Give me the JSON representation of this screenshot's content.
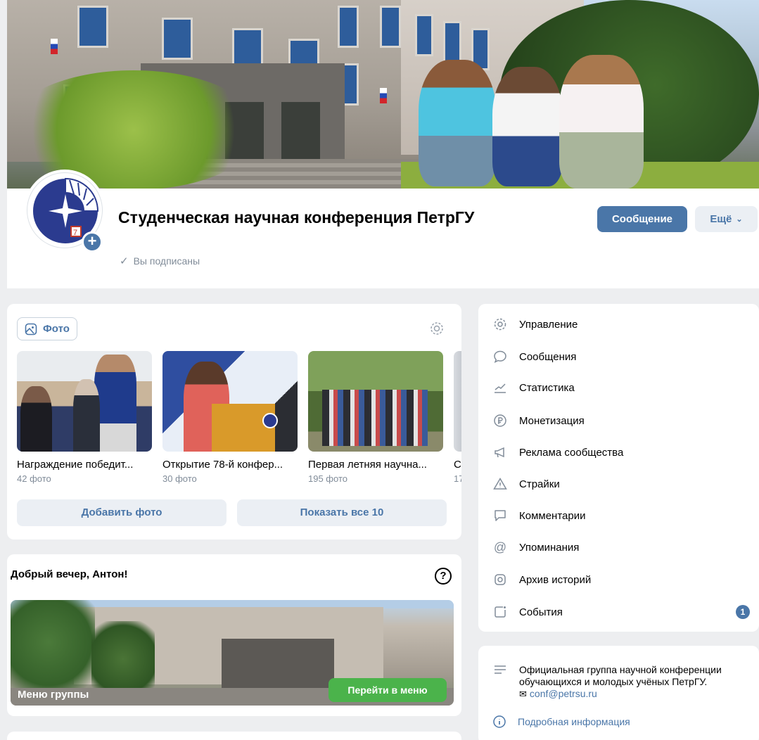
{
  "header": {
    "group_name": "Студенческая научная конференция ПетрГУ",
    "subscribed_label": "Вы подписаны",
    "message_button": "Сообщение",
    "more_button": "Ещё",
    "avatar_plus": "+"
  },
  "photos": {
    "tab_label": "Фото",
    "albums": [
      {
        "name": "Награждение победит...",
        "count": "42 фото"
      },
      {
        "name": "Открытие 78-й конфер...",
        "count": "30 фото"
      },
      {
        "name": "Первая летняя научна...",
        "count": "195 фото"
      },
      {
        "name": "С",
        "count": "17"
      }
    ],
    "add_button": "Добавить фото",
    "show_all_button": "Показать все 10"
  },
  "greeting": {
    "title": "Добрый вечер, Антон!",
    "help": "?",
    "menu_label": "Меню группы",
    "menu_button": "Перейти в меню"
  },
  "side_menu": {
    "items": [
      {
        "label": "Управление",
        "icon": "gear-icon"
      },
      {
        "label": "Сообщения",
        "icon": "chat-bubble-icon"
      },
      {
        "label": "Статистика",
        "icon": "chart-icon"
      },
      {
        "label": "Монетизация",
        "icon": "ruble-icon"
      },
      {
        "label": "Реклама сообщества",
        "icon": "megaphone-icon"
      },
      {
        "label": "Страйки",
        "icon": "warning-icon"
      },
      {
        "label": "Комментарии",
        "icon": "comment-icon"
      },
      {
        "label": "Упоминания",
        "icon": "at-icon"
      },
      {
        "label": "Архив историй",
        "icon": "story-archive-icon"
      },
      {
        "label": "События",
        "icon": "events-icon",
        "badge": "1"
      }
    ]
  },
  "info": {
    "description": "Официальная группа научной конференции обучающихся и молодых учёных ПетрГУ.",
    "email": "conf@petrsu.ru",
    "more_link": "Подробная информация"
  },
  "colors": {
    "accent": "#4a76a8",
    "green": "#4bb34b",
    "secondary_text": "#818c99",
    "page_bg": "#edeef0"
  }
}
